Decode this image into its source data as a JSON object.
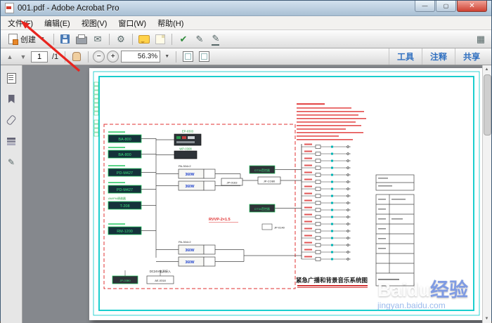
{
  "window": {
    "title": "001.pdf - Adobe Acrobat Pro",
    "controls": {
      "minimize": "—",
      "maximize": "▢",
      "close": "✕"
    }
  },
  "menu": {
    "items": [
      "文件(F)",
      "编辑(E)",
      "视图(V)",
      "窗口(W)",
      "帮助(H)"
    ]
  },
  "toolbar": {
    "create_label": "创建"
  },
  "icons": {
    "gear": "⚙",
    "mail": "✉",
    "pen": "✎",
    "check": "✔",
    "grid": "▦",
    "up": "▲",
    "down": "▼",
    "dropdown": "▼",
    "minus": "−",
    "plus": "+"
  },
  "nav": {
    "page": "1",
    "page_total": "/1",
    "zoom": "56.3%",
    "actions": [
      "工具",
      "注释",
      "共享"
    ]
  },
  "sidebar": {
    "icons": [
      "page-thumbnails",
      "bookmarks",
      "attachments",
      "layers",
      "signatures"
    ]
  },
  "document": {
    "diagram": {
      "equipment": [
        "BA-800",
        "BA-800",
        "PD-M427",
        "PD-M427",
        "T-208",
        "RM-1200",
        "AM/FM调谐器",
        "EP-0303",
        "WP-0308",
        "360W",
        "360W",
        "360W",
        "360W",
        "JP-0163",
        "DT34音控器",
        "DT34音控器",
        "JP-CO80",
        "JP-0140",
        "DC24V电源接入",
        "JP-03B0",
        "AE-0318"
      ],
      "amp_label": "PA-304×2",
      "cable": "RVVP-2×1.5",
      "title": "紧急广播和背景音乐系统图"
    }
  },
  "watermark": {
    "brand_en": "Baidu",
    "brand_cn": "经验",
    "url": "jingyan.baidu.com"
  }
}
